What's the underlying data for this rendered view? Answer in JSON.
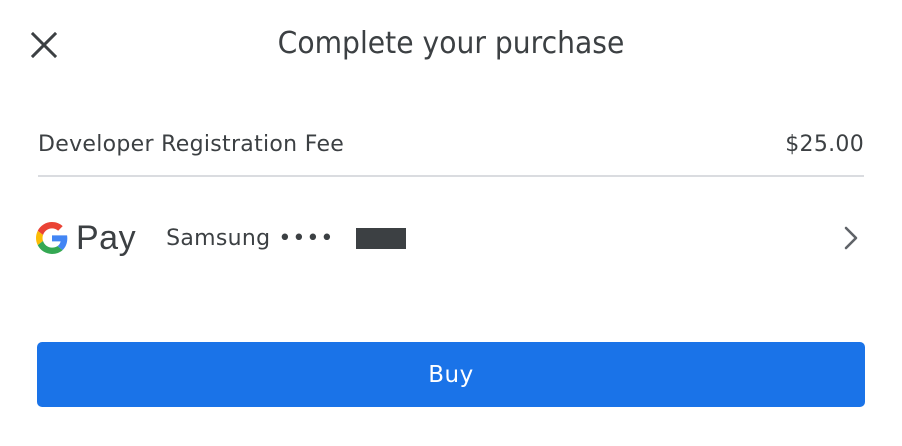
{
  "dialog": {
    "title": "Complete your purchase",
    "close_icon": "close-icon"
  },
  "item": {
    "name": "Developer Registration Fee",
    "price": "$25.00"
  },
  "payment": {
    "provider_logo_icon": "google-g-icon",
    "provider_label": "Pay",
    "card_name": "Samsung",
    "card_mask": "••••",
    "chevron_icon": "chevron-right-icon"
  },
  "actions": {
    "buy_label": "Buy"
  },
  "colors": {
    "primary": "#1a73e8",
    "text": "#3c4043",
    "divider": "#dadce0",
    "google_blue": "#4285F4",
    "google_red": "#EA4335",
    "google_yellow": "#FBBC05",
    "google_green": "#34A853"
  }
}
